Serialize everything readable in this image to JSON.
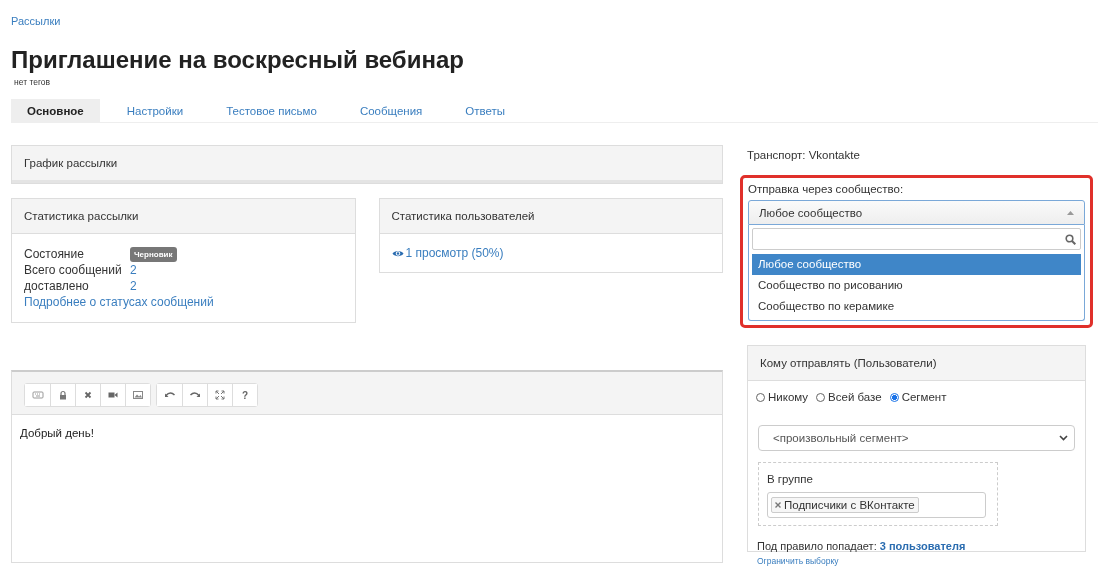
{
  "breadcrumb": "Рассылки",
  "title": "Приглашение на воскресный вебинар",
  "tags": "нет тегов",
  "tabs": [
    {
      "label": "Основное",
      "selected": true
    },
    {
      "label": "Настройки",
      "selected": false
    },
    {
      "label": "Тестовое письмо",
      "selected": false
    },
    {
      "label": "Сообщения",
      "selected": false
    },
    {
      "label": "Ответы",
      "selected": false
    }
  ],
  "schedule_panel": {
    "title": "График рассылки"
  },
  "mailing_stats": {
    "title": "Статистика рассылки",
    "rows": [
      {
        "label": "Состояние",
        "value": "Черновик",
        "kind": "badge"
      },
      {
        "label": "Всего сообщений",
        "value": "2",
        "kind": "link"
      },
      {
        "label": "доставлено",
        "value": "2",
        "kind": "link"
      }
    ],
    "details_link": "Подробнее о статусах сообщений"
  },
  "user_stats": {
    "title": "Статистика пользователей",
    "views": "1 просмотр (50%)"
  },
  "editor": {
    "toolbar": [
      [
        {
          "kind": "keyboard"
        },
        {
          "kind": "lock"
        },
        {
          "kind": "clear"
        },
        {
          "kind": "video"
        },
        {
          "kind": "image"
        }
      ],
      [
        {
          "kind": "undo"
        },
        {
          "kind": "redo"
        },
        {
          "kind": "fullscreen"
        },
        {
          "kind": "help",
          "label": "?"
        }
      ]
    ],
    "content": "Добрый день!"
  },
  "transport": "Транспорт: Vkontakte",
  "community": {
    "label": "Отправка через сообщество:",
    "value": "Любое сообщество",
    "expanded": true,
    "options": [
      {
        "label": "Любое сообщество",
        "selected": true
      },
      {
        "label": "Сообщество по рисованию",
        "selected": false
      },
      {
        "label": "Сообщество по керамике",
        "selected": false
      }
    ]
  },
  "recipients": {
    "title": "Кому отправлять (Пользователи)",
    "radios": [
      {
        "label": "Никому",
        "selected": false
      },
      {
        "label": "Всей базе",
        "selected": false
      },
      {
        "label": "Сегмент",
        "selected": true
      }
    ],
    "segment_select": "<произвольный сегмент>",
    "group": {
      "label": "В группе",
      "tags": [
        "Подписчики с ВКонтакте"
      ]
    },
    "match_text": "Под правило попадает: **3 пользователя**",
    "limit_link": "Ограничить выборку"
  }
}
